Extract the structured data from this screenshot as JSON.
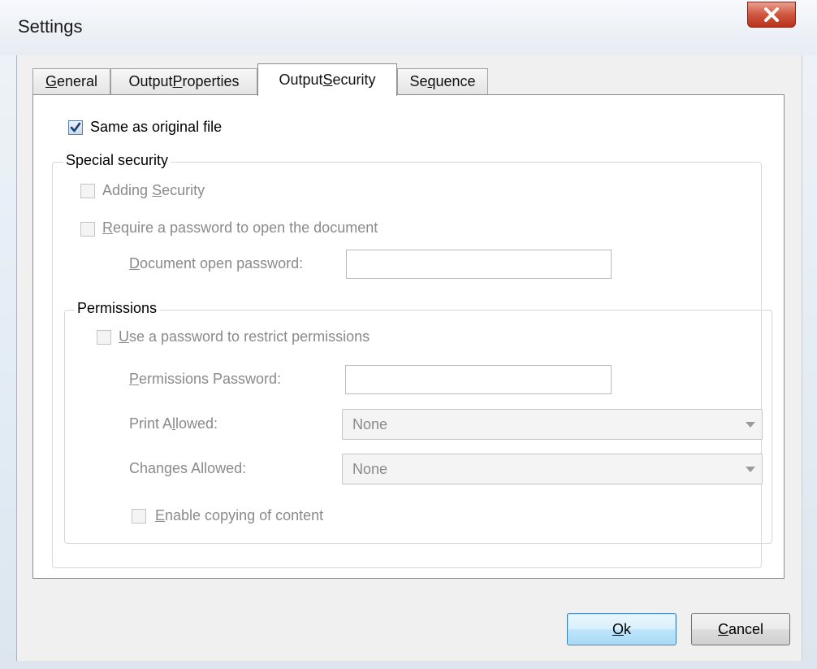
{
  "window": {
    "title": "Settings"
  },
  "tabs": [
    {
      "pre": "",
      "u": "G",
      "post": "eneral"
    },
    {
      "pre": "Output ",
      "u": "P",
      "post": "roperties"
    },
    {
      "pre": "Output ",
      "u": "S",
      "post": "ecurity"
    },
    {
      "pre": "Se",
      "u": "q",
      "post": "uence"
    }
  ],
  "active_tab": "Output Security",
  "security": {
    "same_as_original_label": "Same as original file",
    "same_as_original_checked": true,
    "special_security_title": "Special security",
    "adding_security": {
      "pre": "Adding ",
      "u": "S",
      "post": "ecurity"
    },
    "require_password": {
      "pre": "",
      "u": "R",
      "post": "equire a password to open the document"
    },
    "open_password_label": {
      "pre": "",
      "u": "D",
      "post": "ocument open password:"
    },
    "open_password_value": "",
    "permissions": {
      "title": "Permissions",
      "use_password": {
        "pre": "",
        "u": "U",
        "post": "se a password to restrict permissions"
      },
      "password_label": {
        "pre": "",
        "u": "P",
        "post": "ermissions Password:"
      },
      "password_value": "",
      "print_allowed_label": {
        "pre": "Print A",
        "u": "l",
        "post": "lowed:"
      },
      "print_allowed_value": "None",
      "changes_allowed_label": {
        "pre": "Chan",
        "u": "g",
        "post": "es Allowed:"
      },
      "changes_allowed_value": "None",
      "enable_copying": {
        "pre": "",
        "u": "E",
        "post": "nable copying of content"
      }
    }
  },
  "buttons": {
    "ok": {
      "pre": "",
      "u": "O",
      "post": "k"
    },
    "cancel": {
      "pre": "",
      "u": "C",
      "post": "ancel"
    }
  },
  "colors": {
    "close_button": "#c8432b",
    "default_button_border": "#3c7fb1",
    "disabled_text": "#8a8a8a"
  }
}
